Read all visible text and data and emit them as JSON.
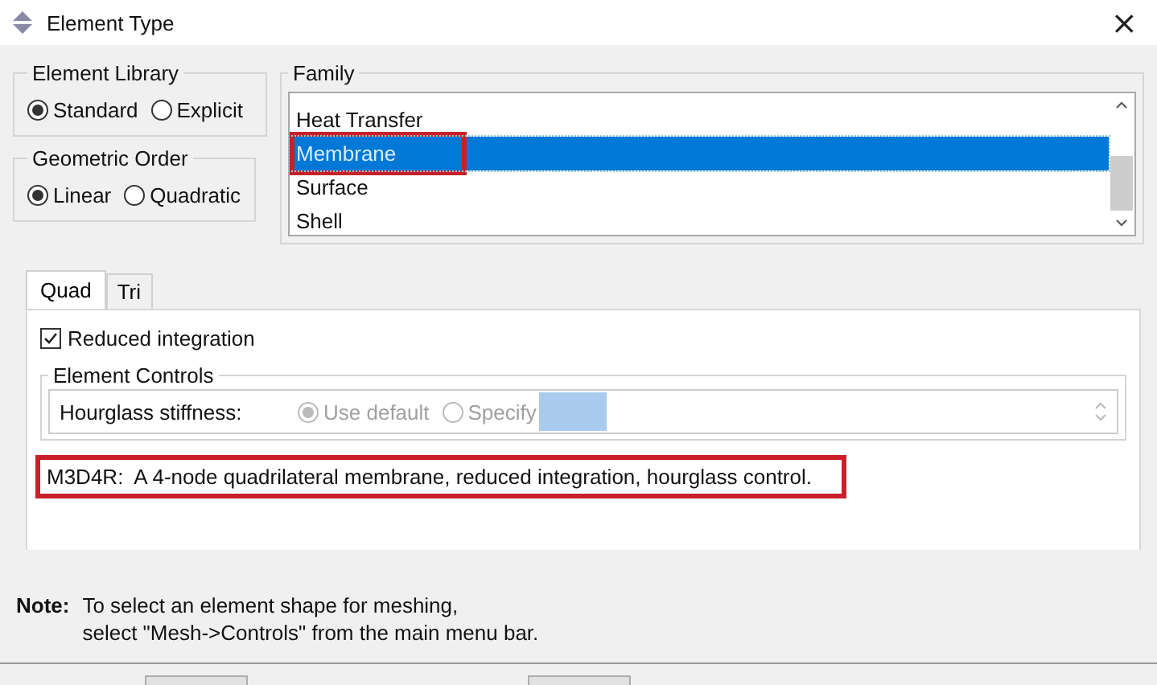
{
  "window": {
    "title": "Element Type",
    "close": "×"
  },
  "element_library": {
    "title": "Element Library",
    "options": [
      {
        "label": "Standard",
        "selected": true
      },
      {
        "label": "Explicit",
        "selected": false
      }
    ]
  },
  "geometric_order": {
    "title": "Geometric Order",
    "options": [
      {
        "label": "Linear",
        "selected": true
      },
      {
        "label": "Quadratic",
        "selected": false
      }
    ]
  },
  "family": {
    "title": "Family",
    "items": [
      {
        "label": "Heat Transfer",
        "selected": false,
        "highlighted": false
      },
      {
        "label": "Membrane",
        "selected": true,
        "highlighted": true
      },
      {
        "label": "Surface",
        "selected": false,
        "highlighted": false
      },
      {
        "label": "Shell",
        "selected": false,
        "highlighted": false
      }
    ]
  },
  "tabs": [
    {
      "label": "Quad",
      "selected": true
    },
    {
      "label": "Tri",
      "selected": false
    }
  ],
  "reduced_integration": {
    "label": "Reduced integration",
    "checked": true
  },
  "element_controls": {
    "title": "Element Controls",
    "label": "Hourglass stiffness:",
    "disabled": true,
    "options": [
      {
        "label": "Use default",
        "selected": true
      },
      {
        "label": "Specify",
        "selected": false
      }
    ]
  },
  "description": {
    "text": "M3D4R:  A 4-node quadrilateral membrane, reduced integration, hourglass control.",
    "highlighted": true
  },
  "note": {
    "label": "Note:",
    "lines": [
      "To select an element shape for meshing,",
      "select \"Mesh->Controls\" from the main menu bar."
    ]
  },
  "buttons": [
    {
      "kind": "button"
    },
    {
      "kind": "button"
    }
  ]
}
